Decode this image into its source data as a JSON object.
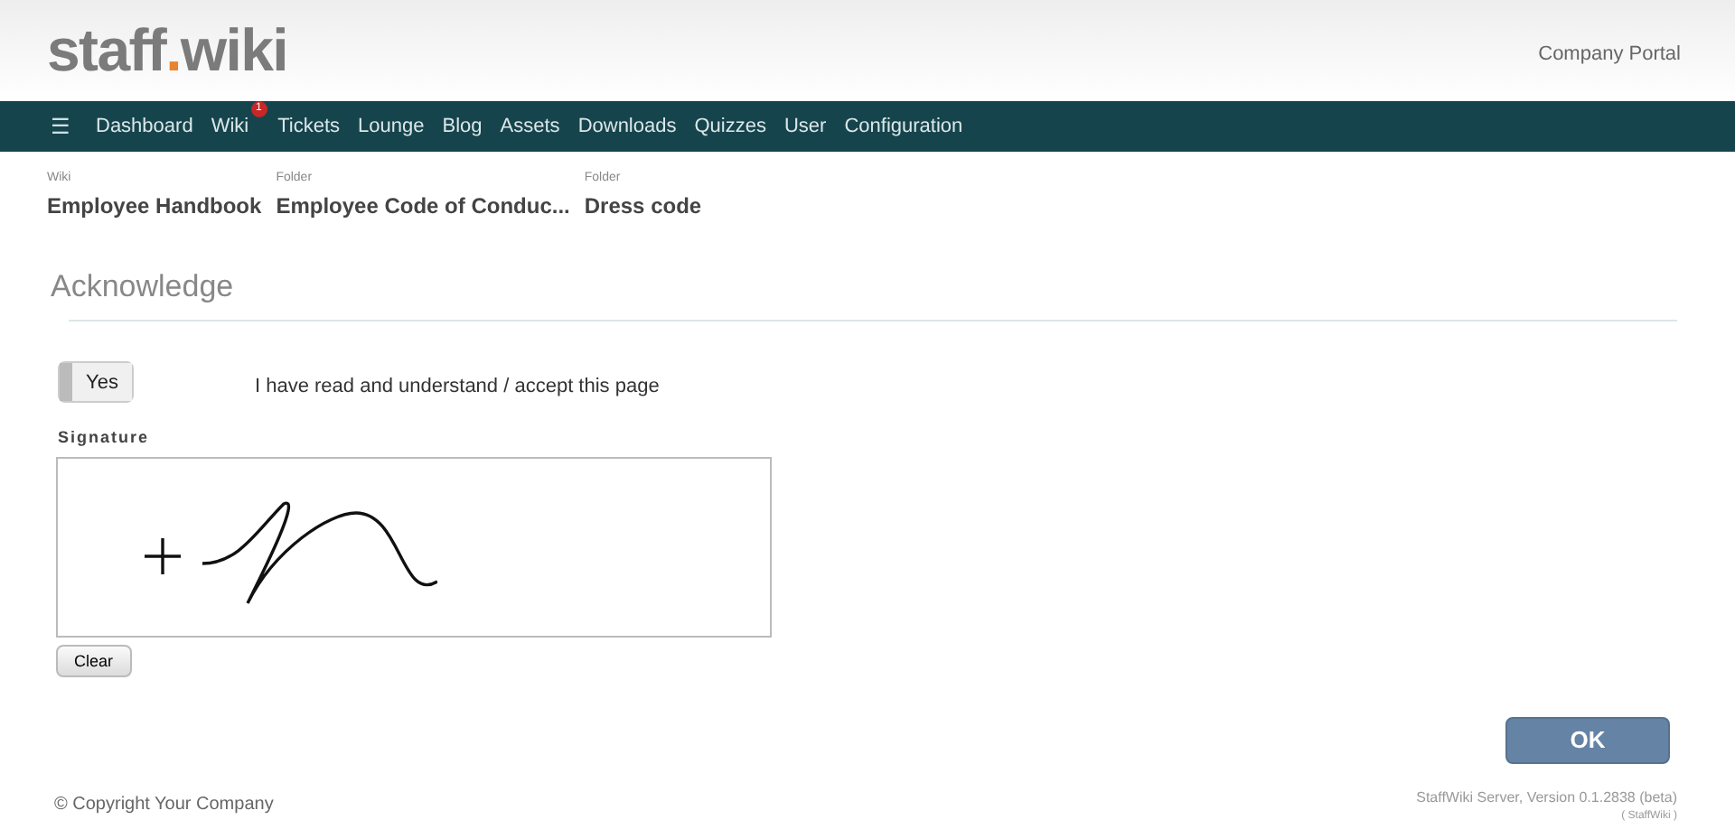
{
  "header": {
    "logo_main": "staff",
    "logo_dot": ".",
    "logo_end": "wiki",
    "portal": "Company Portal"
  },
  "nav": {
    "menu_icon": "☰",
    "items": [
      {
        "label": "Dashboard"
      },
      {
        "label": "Wiki",
        "badge": "1"
      },
      {
        "label": "Tickets"
      },
      {
        "label": "Lounge"
      },
      {
        "label": "Blog"
      },
      {
        "label": "Assets"
      },
      {
        "label": "Downloads"
      },
      {
        "label": "Quizzes"
      },
      {
        "label": "User"
      },
      {
        "label": "Configuration"
      }
    ]
  },
  "breadcrumbs": [
    {
      "kind": "Wiki",
      "title": "Employee Handbook"
    },
    {
      "kind": "Folder",
      "title": "Employee Code of Conduc..."
    },
    {
      "kind": "Folder",
      "title": "Dress code"
    }
  ],
  "section_title": "Acknowledge",
  "acknowledge": {
    "toggle_label": "Yes",
    "on": true,
    "statement": "I have read and understand / accept this page"
  },
  "signature": {
    "label": "Signature",
    "clear_button": "Clear"
  },
  "ok_button": "OK",
  "footer": {
    "copyright": "© Copyright Your Company",
    "version": "StaffWiki Server, Version 0.1.2838 (beta)",
    "edition": "( StaffWiki )"
  }
}
